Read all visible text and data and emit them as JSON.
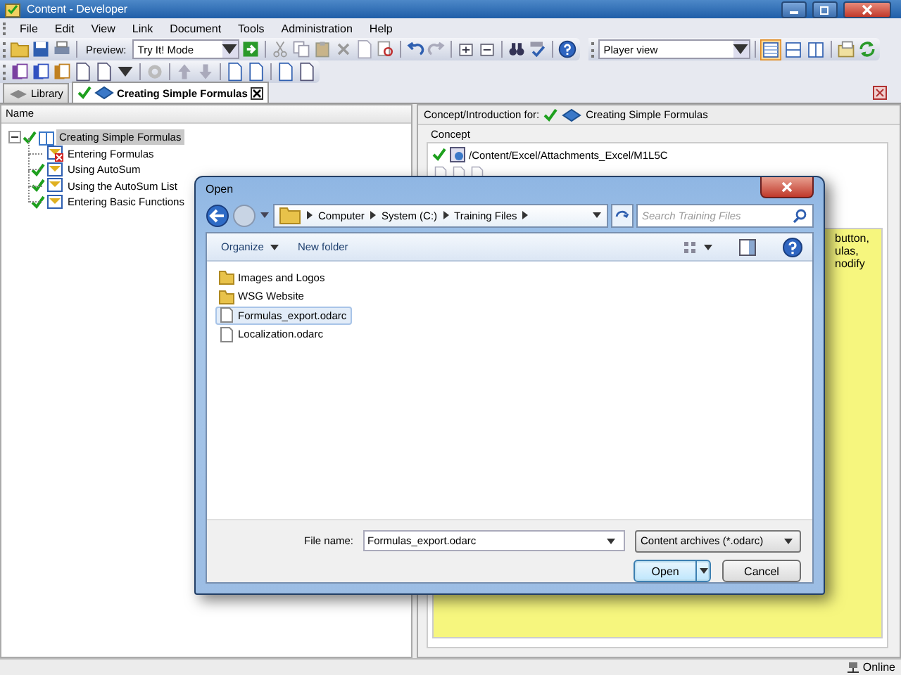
{
  "window": {
    "title": "Content - Developer"
  },
  "menu": [
    "File",
    "Edit",
    "View",
    "Link",
    "Document",
    "Tools",
    "Administration",
    "Help"
  ],
  "toolbar": {
    "preview_label": "Preview:",
    "mode": "Try It! Mode",
    "view": "Player view",
    "layouts": [
      {
        "selected": true
      },
      {
        "selected": false
      },
      {
        "selected": false
      }
    ]
  },
  "tabs": [
    {
      "label": "Library",
      "selected": false,
      "checked": false
    },
    {
      "label": "Creating Simple Formulas",
      "selected": true,
      "checked": true
    }
  ],
  "outline": {
    "column": "Name",
    "items": [
      {
        "label": "Creating Simple Formulas",
        "checked": true,
        "selected": true,
        "expanded": true,
        "children": [
          {
            "label": "Entering Formulas",
            "checked": false,
            "selected": false
          },
          {
            "label": "Using AutoSum",
            "checked": true,
            "selected": false
          },
          {
            "label": "Using the AutoSum List",
            "checked": true,
            "selected": false
          },
          {
            "label": "Entering Basic Functions",
            "checked": true,
            "selected": false
          }
        ]
      }
    ]
  },
  "concept": {
    "heading": "Concept/Introduction for:",
    "document": "Creating Simple Formulas",
    "document_checked": true,
    "group_title": "Concept",
    "path": "/Content/Excel/Attachments_Excel/M1L5C",
    "path_checked": true,
    "note_lines": [
      "button,",
      "ulas,",
      "nodify"
    ]
  },
  "dialog": {
    "title": "Open",
    "breadcrumb": [
      "Computer",
      "System (C:)",
      "Training Files"
    ],
    "search": {
      "placeholder": "Search Training Files"
    },
    "commands": [
      {
        "label": "Organize",
        "menu": true
      },
      {
        "label": "New folder",
        "menu": false
      }
    ],
    "files": [
      {
        "name": "Images and Logos",
        "kind": "folder",
        "selected": false
      },
      {
        "name": "WSG Website",
        "kind": "folder",
        "selected": false
      },
      {
        "name": "Formulas_export.odarc",
        "kind": "file",
        "selected": true
      },
      {
        "name": "Localization.odarc",
        "kind": "file",
        "selected": false
      }
    ],
    "file_name_label": "File name:",
    "file_name": "Formulas_export.odarc",
    "filter": "Content archives (*.odarc)",
    "buttons": [
      {
        "label": "Open",
        "kind": "split",
        "default": true
      },
      {
        "label": "Cancel",
        "kind": "plain",
        "default": false
      }
    ]
  },
  "status_bar": {
    "status": "Online"
  }
}
